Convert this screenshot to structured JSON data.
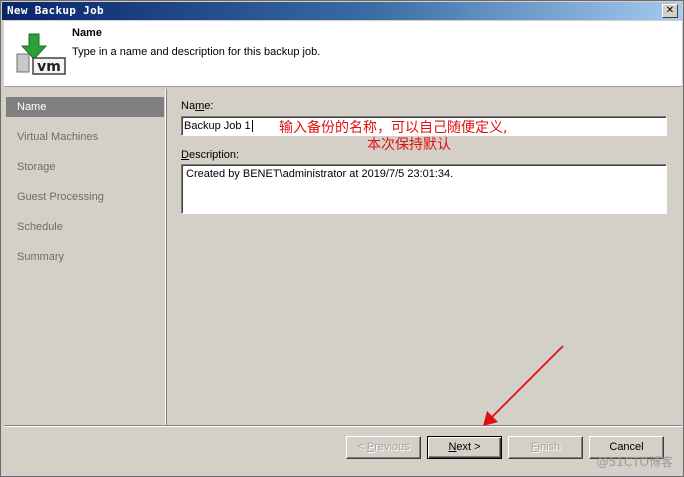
{
  "window": {
    "title": "New Backup Job",
    "close_glyph": "✕"
  },
  "header": {
    "title": "Name",
    "description": "Type in a name and description for this backup job.",
    "icon": "vm-download-icon",
    "icon_text": "vm"
  },
  "sidebar": {
    "items": [
      {
        "label": "Name",
        "active": true
      },
      {
        "label": "Virtual Machines",
        "active": false
      },
      {
        "label": "Storage",
        "active": false
      },
      {
        "label": "Guest Processing",
        "active": false
      },
      {
        "label": "Schedule",
        "active": false
      },
      {
        "label": "Summary",
        "active": false
      }
    ]
  },
  "form": {
    "name_label_prefix": "Na",
    "name_label_hotkey": "m",
    "name_label_suffix": "e:",
    "name_value": "Backup Job 1",
    "description_label_hotkey": "D",
    "description_label_suffix": "escription:",
    "description_value": "Created by BENET\\administrator at 2019/7/5 23:01:34."
  },
  "annotation": {
    "line1": "输入备份的名称，可以自己随便定义,",
    "line2": "本次保持默认",
    "color": "#e01010"
  },
  "buttons": {
    "previous_prefix": "< ",
    "previous_hotkey": "P",
    "previous_suffix": "revious",
    "next_hotkey": "N",
    "next_suffix": "ext >",
    "finish_hotkey": "F",
    "finish_suffix": "inish",
    "cancel_label": "Cancel"
  },
  "watermark": "@51CTO博客"
}
